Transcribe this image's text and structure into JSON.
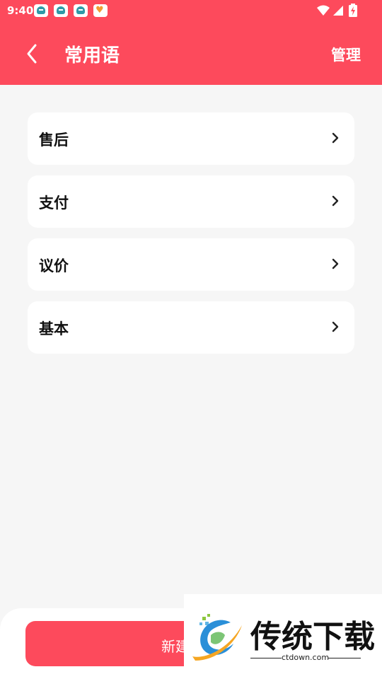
{
  "status_bar": {
    "time": "9:40",
    "icons": [
      "app-notification-icon",
      "app-notification-icon",
      "app-notification-icon",
      "heart-app-icon",
      "wifi-icon",
      "cellular-signal-icon",
      "battery-charging-icon"
    ]
  },
  "header": {
    "title": "常用语",
    "manage_label": "管理",
    "back_icon": "chevron-left-icon",
    "accent_color": "#fd4a5c"
  },
  "categories": [
    {
      "label": "售后",
      "icon": "chevron-right-icon"
    },
    {
      "label": "支付",
      "icon": "chevron-right-icon"
    },
    {
      "label": "议价",
      "icon": "chevron-right-icon"
    },
    {
      "label": "基本",
      "icon": "chevron-right-icon"
    }
  ],
  "bottom": {
    "new_button_label": "新建"
  },
  "watermark": {
    "title": "传统下载",
    "url": "ctdown.com"
  }
}
